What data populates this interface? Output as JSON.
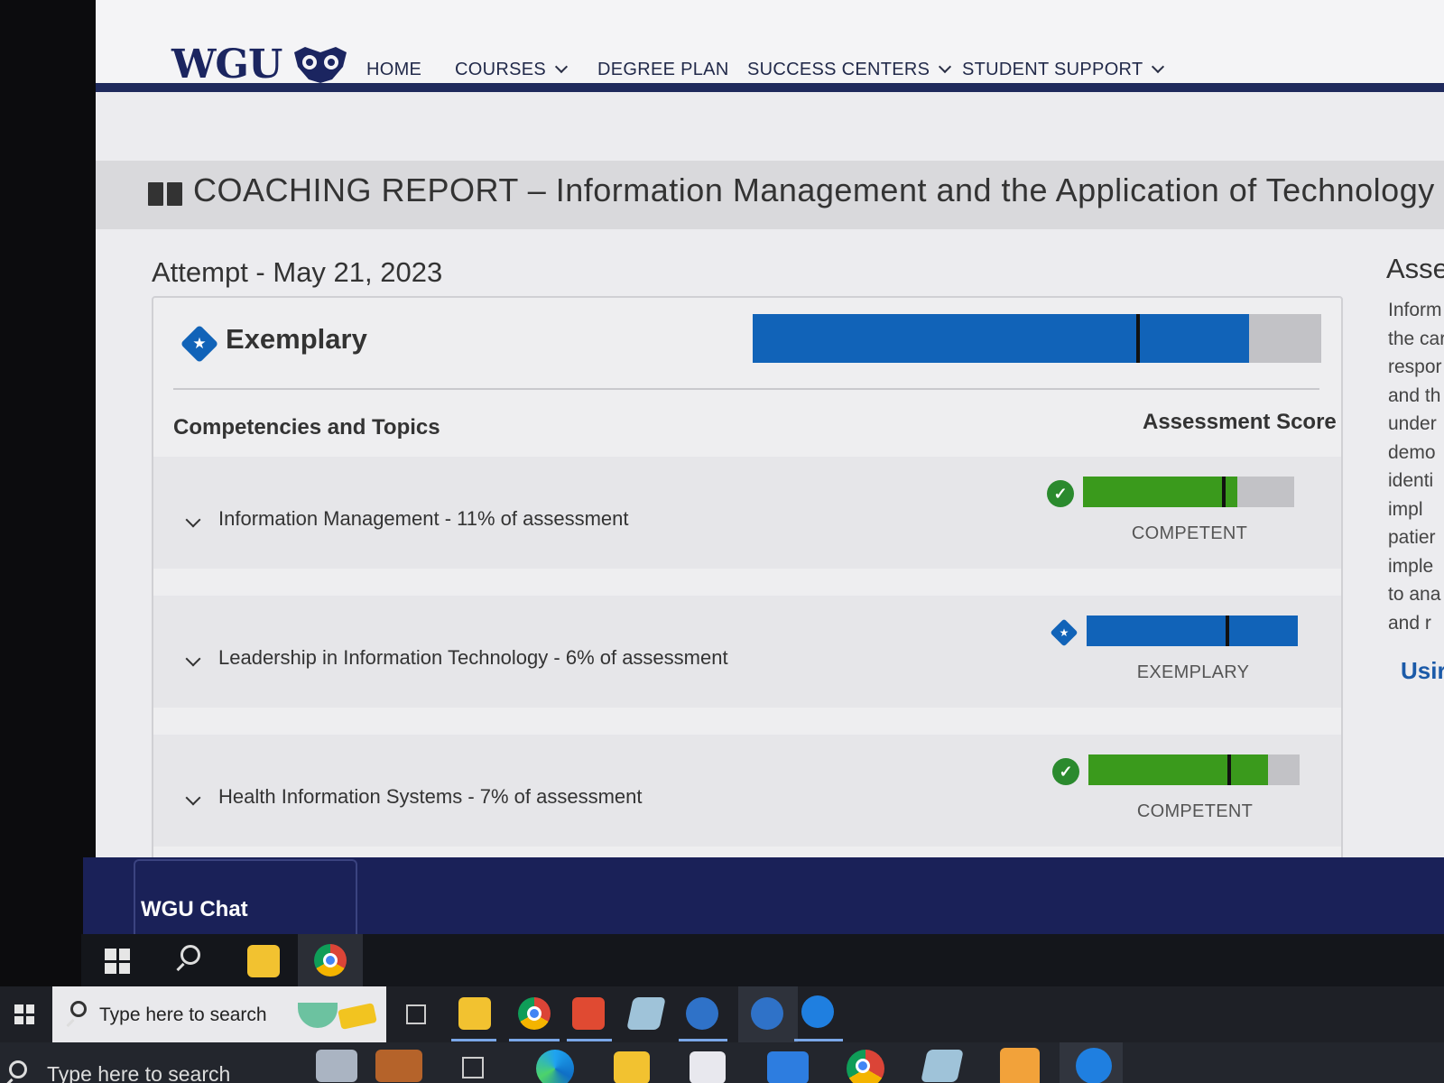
{
  "nav": {
    "logo": "WGU",
    "items": [
      "HOME",
      "COURSES",
      "DEGREE PLAN",
      "SUCCESS CENTERS",
      "STUDENT SUPPORT"
    ]
  },
  "banner": {
    "title": "COACHING REPORT – Information Management and the Application of Technology"
  },
  "attempt": "Attempt - May 21, 2023",
  "overall": {
    "label": "Exemplary",
    "score_fraction": 0.873,
    "cutoff_fraction": 0.675,
    "color": "#1163b8"
  },
  "table": {
    "left_header": "Competencies and Topics",
    "right_header": "Assessment Score"
  },
  "rows": [
    {
      "label": "Information Management - 11% of assessment",
      "status": "COMPETENT",
      "score_fraction": 0.73,
      "cutoff_fraction": 0.66,
      "color": "#3a9a1c"
    },
    {
      "label": "Leadership in Information Technology - 6% of assessment",
      "status": "EXEMPLARY",
      "score_fraction": 1.0,
      "cutoff_fraction": 0.66,
      "color": "#1163b8"
    },
    {
      "label": "Health Information Systems - 7% of assessment",
      "status": "COMPETENT",
      "score_fraction": 0.85,
      "cutoff_fraction": 0.66,
      "color": "#3a9a1c"
    }
  ],
  "side_panel": {
    "heading": "Asse",
    "lines": [
      "Inform",
      "the car",
      "respor",
      "and th",
      "under",
      "demo",
      "identi",
      "impl",
      "patier",
      "imple",
      "to ana",
      "and r"
    ],
    "link": "Usir"
  },
  "chat": {
    "label": "WGU Chat"
  },
  "taskbar": {
    "search_placeholder": "Type here to search"
  },
  "colors": {
    "navy": "#1f2a5c",
    "competent_green": "#3a9a1c",
    "exemplary_blue": "#1163b8"
  }
}
